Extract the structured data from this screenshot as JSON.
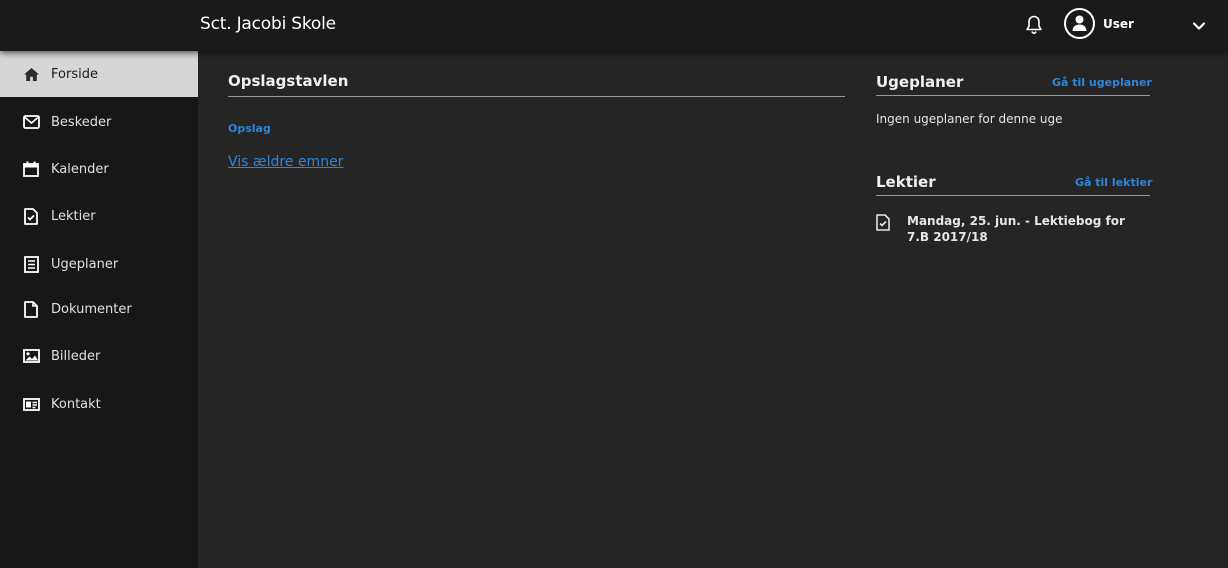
{
  "header": {
    "school_name": "Sct. Jacobi Skole",
    "user_name": "User",
    "icons": [
      "bell-icon",
      "user-avatar-icon",
      "chevron-down-icon"
    ]
  },
  "sidebar": {
    "items": [
      {
        "label": "Forside",
        "icon": "home-icon",
        "active": true
      },
      {
        "label": "Beskeder",
        "icon": "envelope-icon",
        "active": false
      },
      {
        "label": "Kalender",
        "icon": "calendar-icon",
        "active": false
      },
      {
        "label": "Lektier",
        "icon": "homework-icon",
        "active": false
      },
      {
        "label": "Ugeplaner",
        "icon": "checklist-icon",
        "active": false
      },
      {
        "label": "Dokumenter",
        "icon": "document-icon",
        "active": false
      },
      {
        "label": "Billeder",
        "icon": "image-icon",
        "active": false
      },
      {
        "label": "Kontakt",
        "icon": "contact-card-icon",
        "active": false
      }
    ]
  },
  "bulletin": {
    "title": "Opslagstavlen",
    "posts_link": "Opslag",
    "older_link": "Vis ældre emner"
  },
  "weekplans": {
    "title": "Ugeplaner",
    "go_link": "Gå til ugeplaner",
    "empty_text": "Ingen ugeplaner for denne uge"
  },
  "homework": {
    "title": "Lektier",
    "go_link": "Gå til lektier",
    "items": [
      {
        "text": "Mandag, 25. jun. - Lektiebog for 7.B 2017/18",
        "icon": "homework-icon"
      }
    ]
  },
  "colors": {
    "accent_link": "#2f86d9",
    "active_nav": "#d6d6d6",
    "sidebar_bg": "#171717",
    "main_bg": "#252525",
    "topbar_bg": "#1a1a1a"
  }
}
